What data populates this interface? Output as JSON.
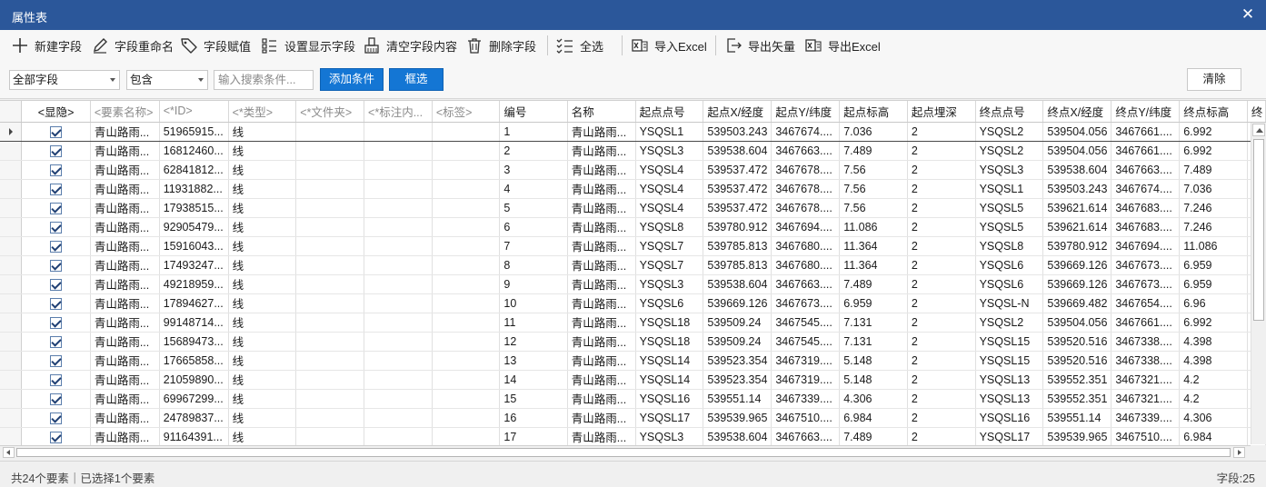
{
  "window": {
    "title": "属性表",
    "close_glyph": "✕"
  },
  "toolbar": {
    "new_field": "新建字段",
    "rename_field": "字段重命名",
    "assign_field": "字段赋值",
    "display_fields": "设置显示字段",
    "clear_field": "清空字段内容",
    "delete_field": "删除字段",
    "select_all": "全选",
    "import_excel": "导入Excel",
    "export_vector": "导出矢量",
    "export_excel": "导出Excel"
  },
  "filter": {
    "field_select": "全部字段",
    "op_select": "包含",
    "search_placeholder": "输入搜索条件...",
    "add_condition": "添加条件",
    "box_select": "框选",
    "clear": "清除"
  },
  "table": {
    "columns": [
      "<显隐>",
      "<要素名称>",
      "<*ID>",
      "<*类型>",
      "<*文件夹>",
      "<*标注内...",
      "<标签>",
      "编号",
      "名称",
      "起点点号",
      "起点X/经度",
      "起点Y/纬度",
      "起点标高",
      "起点埋深",
      "终点点号",
      "终点X/经度",
      "终点Y/纬度",
      "终点标高",
      "终"
    ],
    "rows": [
      [
        "青山路雨...",
        "51965915...",
        "线",
        "",
        "",
        "",
        "1",
        "青山路雨...",
        "YSQSL1",
        "539503.243",
        "3467674....",
        "7.036",
        "2",
        "YSQSL2",
        "539504.056",
        "3467661....",
        "6.992"
      ],
      [
        "青山路雨...",
        "16812460...",
        "线",
        "",
        "",
        "",
        "2",
        "青山路雨...",
        "YSQSL3",
        "539538.604",
        "3467663....",
        "7.489",
        "2",
        "YSQSL2",
        "539504.056",
        "3467661....",
        "6.992"
      ],
      [
        "青山路雨...",
        "62841812...",
        "线",
        "",
        "",
        "",
        "3",
        "青山路雨...",
        "YSQSL4",
        "539537.472",
        "3467678....",
        "7.56",
        "2",
        "YSQSL3",
        "539538.604",
        "3467663....",
        "7.489"
      ],
      [
        "青山路雨...",
        "11931882...",
        "线",
        "",
        "",
        "",
        "4",
        "青山路雨...",
        "YSQSL4",
        "539537.472",
        "3467678....",
        "7.56",
        "2",
        "YSQSL1",
        "539503.243",
        "3467674....",
        "7.036"
      ],
      [
        "青山路雨...",
        "17938515...",
        "线",
        "",
        "",
        "",
        "5",
        "青山路雨...",
        "YSQSL4",
        "539537.472",
        "3467678....",
        "7.56",
        "2",
        "YSQSL5",
        "539621.614",
        "3467683....",
        "7.246"
      ],
      [
        "青山路雨...",
        "92905479...",
        "线",
        "",
        "",
        "",
        "6",
        "青山路雨...",
        "YSQSL8",
        "539780.912",
        "3467694....",
        "11.086",
        "2",
        "YSQSL5",
        "539621.614",
        "3467683....",
        "7.246"
      ],
      [
        "青山路雨...",
        "15916043...",
        "线",
        "",
        "",
        "",
        "7",
        "青山路雨...",
        "YSQSL7",
        "539785.813",
        "3467680....",
        "11.364",
        "2",
        "YSQSL8",
        "539780.912",
        "3467694....",
        "11.086"
      ],
      [
        "青山路雨...",
        "17493247...",
        "线",
        "",
        "",
        "",
        "8",
        "青山路雨...",
        "YSQSL7",
        "539785.813",
        "3467680....",
        "11.364",
        "2",
        "YSQSL6",
        "539669.126",
        "3467673....",
        "6.959"
      ],
      [
        "青山路雨...",
        "49218959...",
        "线",
        "",
        "",
        "",
        "9",
        "青山路雨...",
        "YSQSL3",
        "539538.604",
        "3467663....",
        "7.489",
        "2",
        "YSQSL6",
        "539669.126",
        "3467673....",
        "6.959"
      ],
      [
        "青山路雨...",
        "17894627...",
        "线",
        "",
        "",
        "",
        "10",
        "青山路雨...",
        "YSQSL6",
        "539669.126",
        "3467673....",
        "6.959",
        "2",
        "YSQSL-N",
        "539669.482",
        "3467654....",
        "6.96"
      ],
      [
        "青山路雨...",
        "99148714...",
        "线",
        "",
        "",
        "",
        "11",
        "青山路雨...",
        "YSQSL18",
        "539509.24",
        "3467545....",
        "7.131",
        "2",
        "YSQSL2",
        "539504.056",
        "3467661....",
        "6.992"
      ],
      [
        "青山路雨...",
        "15689473...",
        "线",
        "",
        "",
        "",
        "12",
        "青山路雨...",
        "YSQSL18",
        "539509.24",
        "3467545....",
        "7.131",
        "2",
        "YSQSL15",
        "539520.516",
        "3467338....",
        "4.398"
      ],
      [
        "青山路雨...",
        "17665858...",
        "线",
        "",
        "",
        "",
        "13",
        "青山路雨...",
        "YSQSL14",
        "539523.354",
        "3467319....",
        "5.148",
        "2",
        "YSQSL15",
        "539520.516",
        "3467338....",
        "4.398"
      ],
      [
        "青山路雨...",
        "21059890...",
        "线",
        "",
        "",
        "",
        "14",
        "青山路雨...",
        "YSQSL14",
        "539523.354",
        "3467319....",
        "5.148",
        "2",
        "YSQSL13",
        "539552.351",
        "3467321....",
        "4.2"
      ],
      [
        "青山路雨...",
        "69967299...",
        "线",
        "",
        "",
        "",
        "15",
        "青山路雨...",
        "YSQSL16",
        "539551.14",
        "3467339....",
        "4.306",
        "2",
        "YSQSL13",
        "539552.351",
        "3467321....",
        "4.2"
      ],
      [
        "青山路雨...",
        "24789837...",
        "线",
        "",
        "",
        "",
        "16",
        "青山路雨...",
        "YSQSL17",
        "539539.965",
        "3467510....",
        "6.984",
        "2",
        "YSQSL16",
        "539551.14",
        "3467339....",
        "4.306"
      ],
      [
        "青山路雨...",
        "91164391...",
        "线",
        "",
        "",
        "",
        "17",
        "青山路雨...",
        "YSQSL3",
        "539538.604",
        "3467663....",
        "7.489",
        "2",
        "YSQSL17",
        "539539.965",
        "3467510....",
        "6.984"
      ]
    ]
  },
  "status": {
    "summary": "共24个要素｜已选择1个要素",
    "field_count": "字段:25"
  }
}
